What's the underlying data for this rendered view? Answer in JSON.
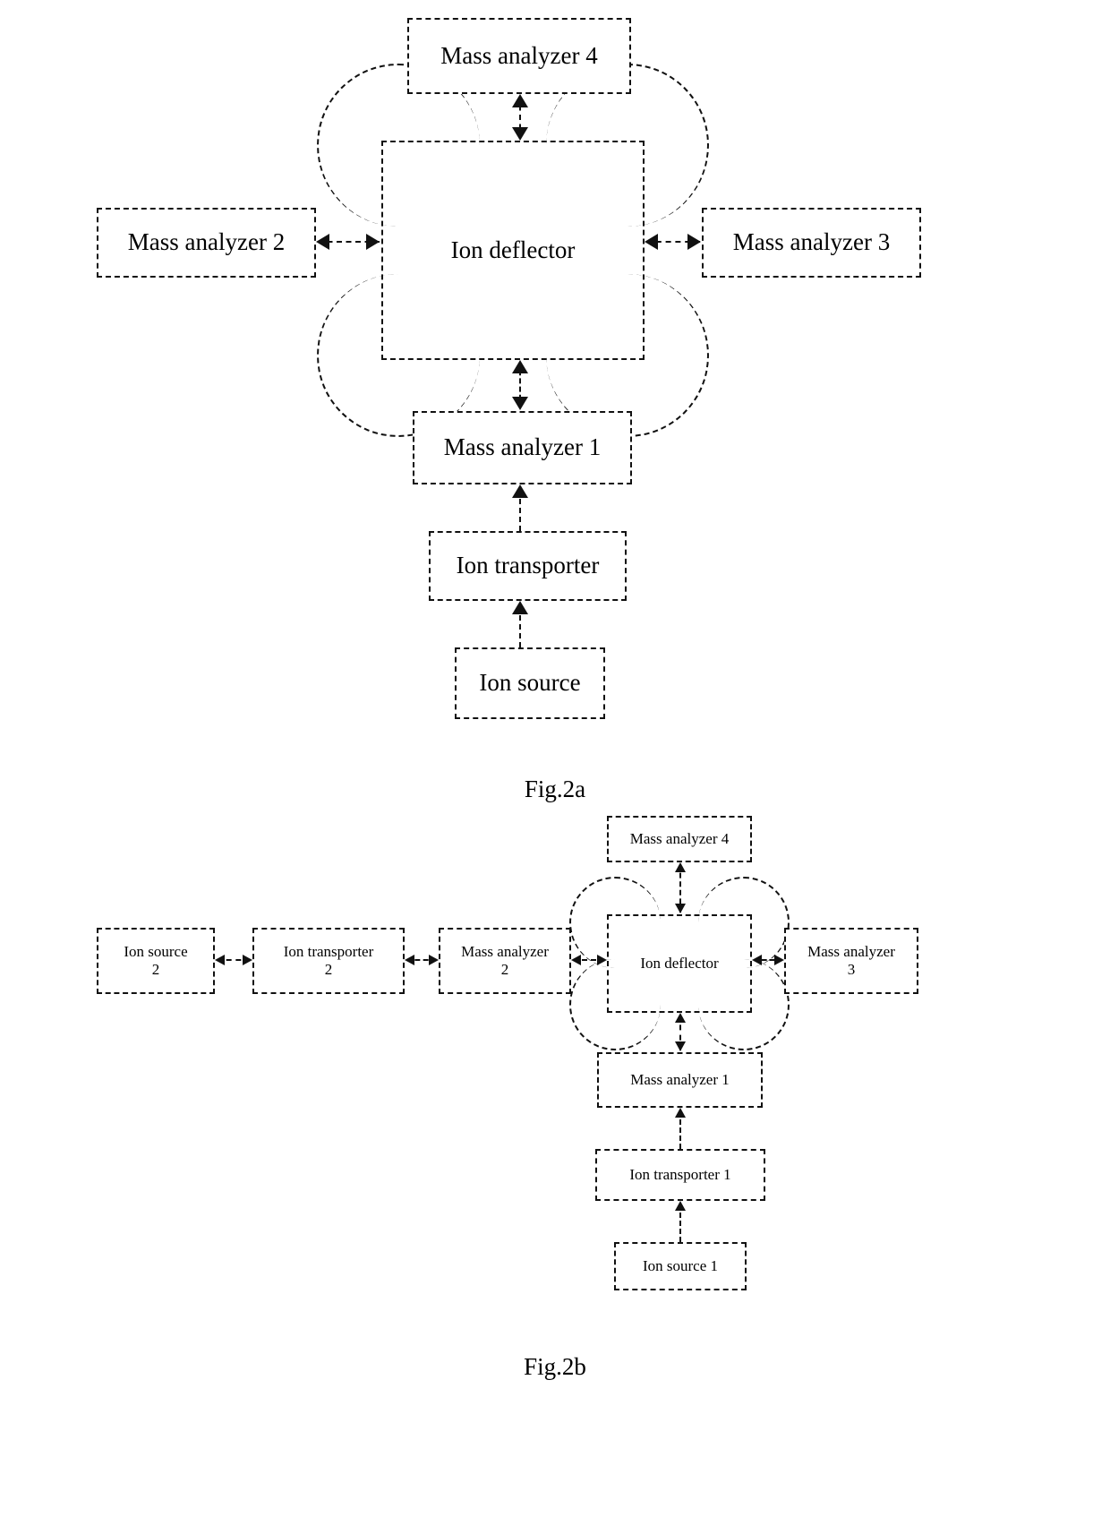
{
  "document": {
    "type": "patent-figure-sheet",
    "figures": [
      {
        "id": "fig2a",
        "caption": "Fig.2a",
        "blocks": {
          "mass_analyzer_4": {
            "label": "Mass analyzer 4"
          },
          "mass_analyzer_2": {
            "label": "Mass analyzer 2"
          },
          "mass_analyzer_3": {
            "label": "Mass analyzer 3"
          },
          "ion_deflector": {
            "label": "Ion deflector"
          },
          "mass_analyzer_1": {
            "label": "Mass analyzer 1"
          },
          "ion_transporter": {
            "label": "Ion transporter"
          },
          "ion_source": {
            "label": "Ion source"
          }
        },
        "connections": [
          {
            "from": "ion_deflector",
            "to": "mass_analyzer_4",
            "style": "dashed",
            "arrows": "both",
            "orientation": "vertical"
          },
          {
            "from": "ion_deflector",
            "to": "mass_analyzer_2",
            "style": "dashed",
            "arrows": "both",
            "orientation": "horizontal"
          },
          {
            "from": "ion_deflector",
            "to": "mass_analyzer_3",
            "style": "dashed",
            "arrows": "both",
            "orientation": "horizontal"
          },
          {
            "from": "mass_analyzer_1",
            "to": "ion_deflector",
            "style": "dashed",
            "arrows": "both",
            "orientation": "vertical"
          },
          {
            "from": "ion_transporter",
            "to": "mass_analyzer_1",
            "style": "dashed",
            "arrows": "single-up",
            "orientation": "vertical"
          },
          {
            "from": "ion_source",
            "to": "ion_transporter",
            "style": "dashed",
            "arrows": "single-up",
            "orientation": "vertical"
          }
        ]
      },
      {
        "id": "fig2b",
        "caption": "Fig.2b",
        "blocks": {
          "ion_source_2": {
            "label": "Ion source",
            "sub": "2"
          },
          "ion_transporter_2": {
            "label": "Ion transporter",
            "sub": "2"
          },
          "mass_analyzer_2": {
            "label": "Mass analyzer",
            "sub": "2"
          },
          "mass_analyzer_3": {
            "label": "Mass analyzer",
            "sub": "3"
          },
          "mass_analyzer_4": {
            "label": "Mass analyzer 4",
            "sub": ""
          },
          "ion_deflector": {
            "label": "Ion deflector",
            "sub": ""
          },
          "mass_analyzer_1": {
            "label": "Mass analyzer 1",
            "sub": ""
          },
          "ion_transporter_1": {
            "label": "Ion transporter 1",
            "sub": ""
          },
          "ion_source_1": {
            "label": "Ion source 1",
            "sub": ""
          }
        },
        "connections": [
          {
            "from": "ion_source_2",
            "to": "ion_transporter_2",
            "style": "dashed",
            "arrows": "both",
            "orientation": "horizontal"
          },
          {
            "from": "ion_transporter_2",
            "to": "mass_analyzer_2",
            "style": "dashed",
            "arrows": "both",
            "orientation": "horizontal"
          },
          {
            "from": "mass_analyzer_2",
            "to": "ion_deflector",
            "style": "dashed",
            "arrows": "both",
            "orientation": "horizontal"
          },
          {
            "from": "ion_deflector",
            "to": "mass_analyzer_3",
            "style": "dashed",
            "arrows": "both",
            "orientation": "horizontal"
          },
          {
            "from": "ion_deflector",
            "to": "mass_analyzer_4",
            "style": "dashed",
            "arrows": "both",
            "orientation": "vertical"
          },
          {
            "from": "mass_analyzer_1",
            "to": "ion_deflector",
            "style": "dashed",
            "arrows": "both",
            "orientation": "vertical"
          },
          {
            "from": "ion_transporter_1",
            "to": "mass_analyzer_1",
            "style": "dashed",
            "arrows": "single-up",
            "orientation": "vertical"
          },
          {
            "from": "ion_source_1",
            "to": "ion_transporter_1",
            "style": "dashed",
            "arrows": "single-up",
            "orientation": "vertical"
          }
        ]
      }
    ]
  },
  "colors": {
    "stroke": "#111111",
    "background": "#ffffff"
  }
}
